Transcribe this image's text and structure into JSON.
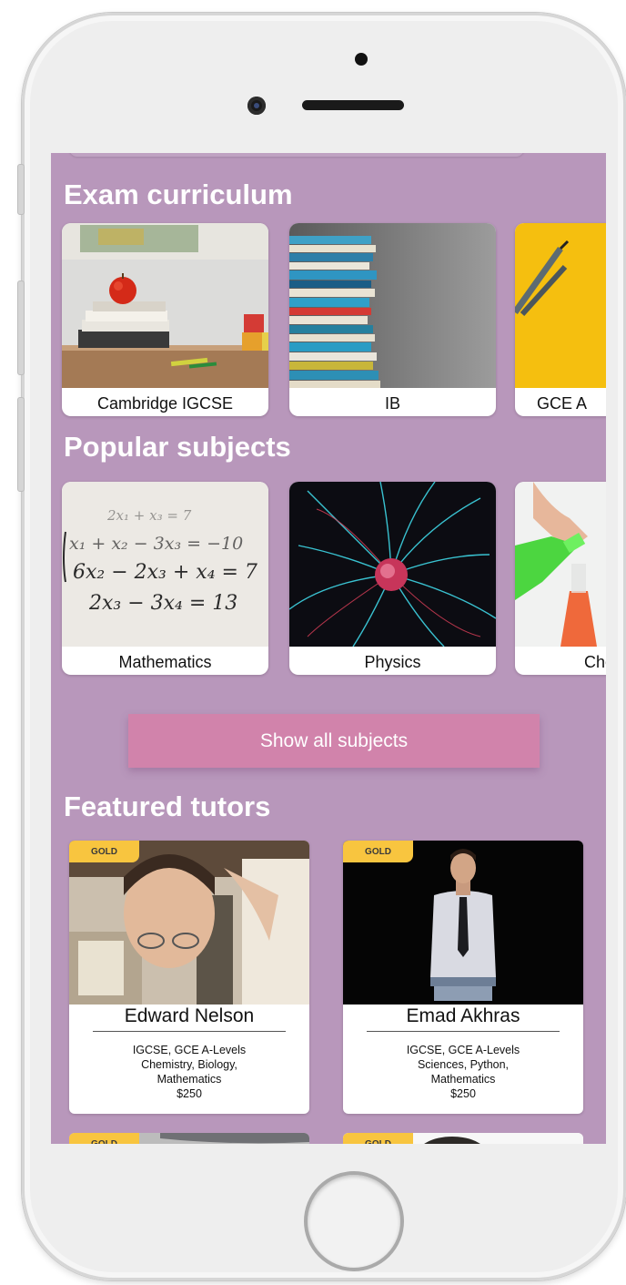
{
  "sections": {
    "exam_curriculum": {
      "title": "Exam curriculum",
      "items": [
        {
          "label": "Cambridge IGCSE"
        },
        {
          "label": "IB"
        },
        {
          "label": "GCE A"
        }
      ]
    },
    "popular_subjects": {
      "title": "Popular subjects",
      "items": [
        {
          "label": "Mathematics"
        },
        {
          "label": "Physics"
        },
        {
          "label": "Che"
        }
      ],
      "show_all_label": "Show all subjects"
    },
    "featured_tutors": {
      "title": "Featured tutors",
      "tutors": [
        {
          "badge": "GOLD",
          "name": "Edward Nelson",
          "curricula": "IGCSE, GCE A-Levels",
          "subjects_line1": "Chemistry, Biology,",
          "subjects_line2": "Mathematics",
          "price": "$250"
        },
        {
          "badge": "GOLD",
          "name": "Emad Akhras",
          "curricula": "IGCSE, GCE A-Levels",
          "subjects_line1": "Sciences, Python,",
          "subjects_line2": "Mathematics",
          "price": "$250"
        }
      ],
      "next_row_badges": [
        "GOLD",
        "GOLD"
      ]
    }
  },
  "colors": {
    "screen_background": "#b897bb",
    "button_background": "#d183ab",
    "badge_gold": "#f8c53f"
  }
}
